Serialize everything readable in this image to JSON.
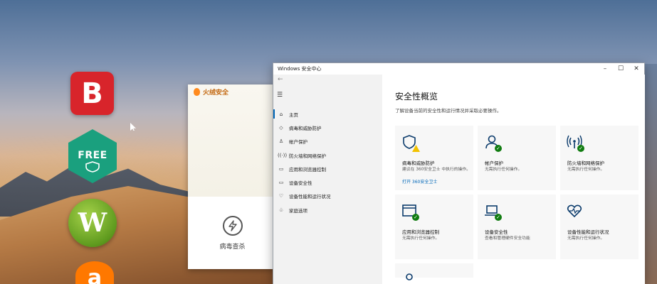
{
  "desktop": {
    "icons": [
      {
        "name": "bitdefender",
        "glyph": "B",
        "color": "#d8242b"
      },
      {
        "name": "kaspersky-free",
        "glyph": "FREE",
        "color": "#1aa07e"
      },
      {
        "name": "webroot",
        "glyph": "W",
        "color": "#6aa42a"
      },
      {
        "name": "avast",
        "glyph": "a",
        "color": "#ff7800"
      }
    ]
  },
  "huorong": {
    "title": "火绒安全",
    "scan_label": "病毒查杀",
    "accent": "#ff8a1e"
  },
  "window": {
    "title": "Windows 安全中心",
    "controls": {
      "minimize": "–",
      "maximize": "☐",
      "close": "✕"
    },
    "back_glyph": "←",
    "menu_glyph": "☰",
    "nav": [
      {
        "icon": "⌂",
        "label": "主页",
        "active": true
      },
      {
        "icon": "◇",
        "label": "病毒和威胁防护"
      },
      {
        "icon": "♙",
        "label": "帐户保护"
      },
      {
        "icon": "((·))",
        "label": "防火墙和网络保护"
      },
      {
        "icon": "▭",
        "label": "应用和浏览器控制"
      },
      {
        "icon": "▭",
        "label": "设备安全性"
      },
      {
        "icon": "♡",
        "label": "设备性能和运行状况"
      },
      {
        "icon": "♧",
        "label": "家庭选项"
      }
    ],
    "content": {
      "title": "安全性概览",
      "subtitle": "了解设备当前的安全性和运行情况并采取必要操作。",
      "tiles": [
        {
          "name": "病毒和威胁防护",
          "desc": "建议在 360安全卫士 中执行的操作。",
          "link": "打开 360安全卫士",
          "status": "warning"
        },
        {
          "name": "帐户保护",
          "desc": "无需执行任何操作。",
          "status": "ok"
        },
        {
          "name": "防火墙和网络保护",
          "desc": "无需执行任何操作。",
          "status": "ok"
        },
        {
          "name": "应用和浏览器控制",
          "desc": "无需执行任何操作。",
          "status": "ok"
        },
        {
          "name": "设备安全性",
          "desc": "查看和管理硬件安全功能",
          "status": "ok"
        },
        {
          "name": "设备性能和运行状况",
          "desc": "无需执行任何操作。",
          "status": "ok"
        }
      ]
    },
    "colors": {
      "accent": "#0067b8",
      "ok": "#107c10",
      "warning": "#f2c200"
    }
  }
}
